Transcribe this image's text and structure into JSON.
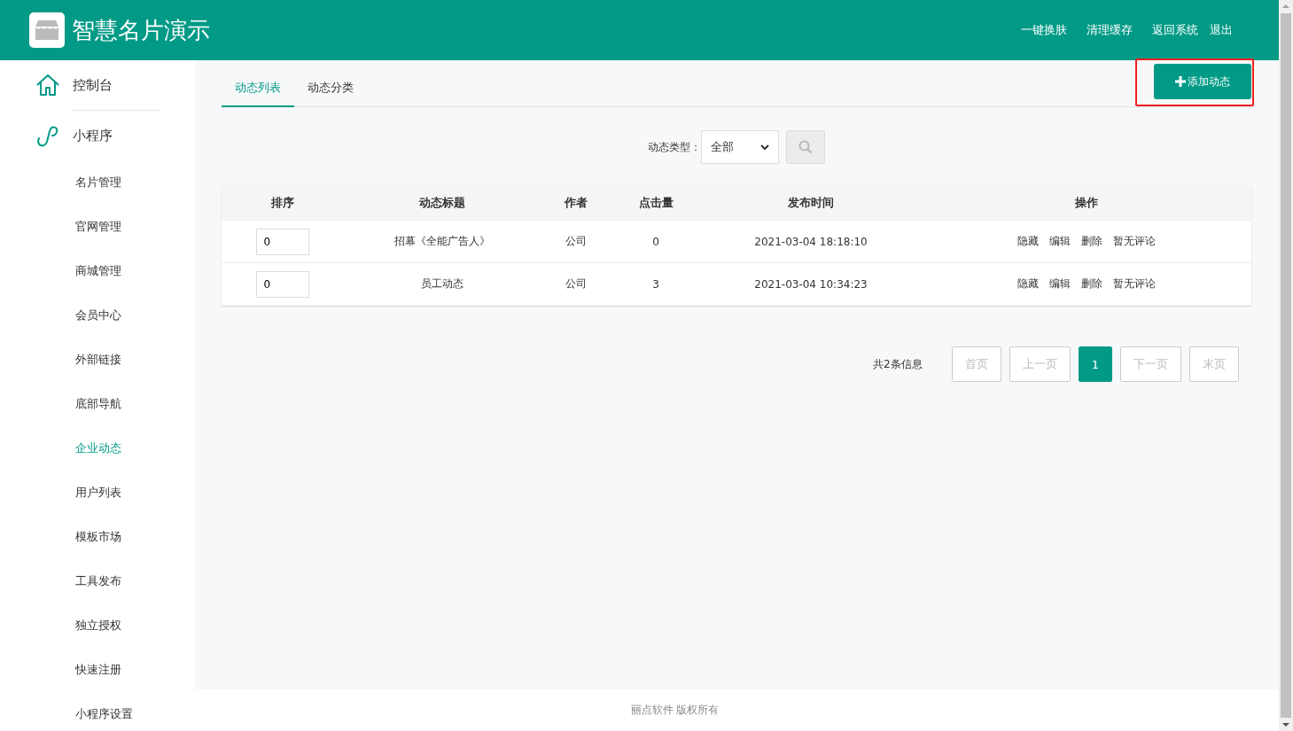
{
  "header": {
    "title": "智慧名片演示",
    "links": [
      "一键换肤",
      "清理缓存",
      "返回系统",
      "退出"
    ]
  },
  "sidebar": {
    "top_items": [
      {
        "label": "控制台",
        "kind": "home"
      },
      {
        "label": "小程序",
        "kind": "miniapp"
      }
    ],
    "items": [
      {
        "label": "名片管理",
        "selected": false
      },
      {
        "label": "官网管理",
        "selected": false
      },
      {
        "label": "商城管理",
        "selected": false
      },
      {
        "label": "会员中心",
        "selected": false
      },
      {
        "label": "外部链接",
        "selected": false
      },
      {
        "label": "底部导航",
        "selected": false
      },
      {
        "label": "企业动态",
        "selected": true
      },
      {
        "label": "用户列表",
        "selected": false
      },
      {
        "label": "模板市场",
        "selected": false
      },
      {
        "label": "工具发布",
        "selected": false
      },
      {
        "label": "独立授权",
        "selected": false
      },
      {
        "label": "快速注册",
        "selected": false
      },
      {
        "label": "小程序设置",
        "selected": false
      }
    ]
  },
  "tabs": [
    {
      "label": "动态列表",
      "selected": true
    },
    {
      "label": "动态分类",
      "selected": false
    }
  ],
  "add_button": {
    "label": "添加动态",
    "highlighted": true
  },
  "filter": {
    "label": "动态类型：",
    "value": "全部"
  },
  "table": {
    "columns": [
      "排序",
      "动态标题",
      "作者",
      "点击量",
      "发布时间",
      "操作"
    ],
    "rows": [
      {
        "sort": "0",
        "title": "招幕《全能广告人》",
        "author": "公司",
        "clicks": "0",
        "time": "2021-03-04 18:18:10",
        "actions": [
          "隐藏",
          "编辑",
          "删除",
          "暂无评论"
        ]
      },
      {
        "sort": "0",
        "title": "员工动态",
        "author": "公司",
        "clicks": "3",
        "time": "2021-03-04 10:34:23",
        "actions": [
          "隐藏",
          "编辑",
          "删除",
          "暂无评论"
        ]
      }
    ]
  },
  "pagination": {
    "total": "共2条信息",
    "pages": [
      {
        "label": "首页",
        "selected": false
      },
      {
        "label": "上一页",
        "selected": false
      },
      {
        "label": "1",
        "selected": true
      },
      {
        "label": "下一页",
        "selected": false
      },
      {
        "label": "末页",
        "selected": false
      }
    ]
  },
  "footer": "丽点软件 版权所有"
}
